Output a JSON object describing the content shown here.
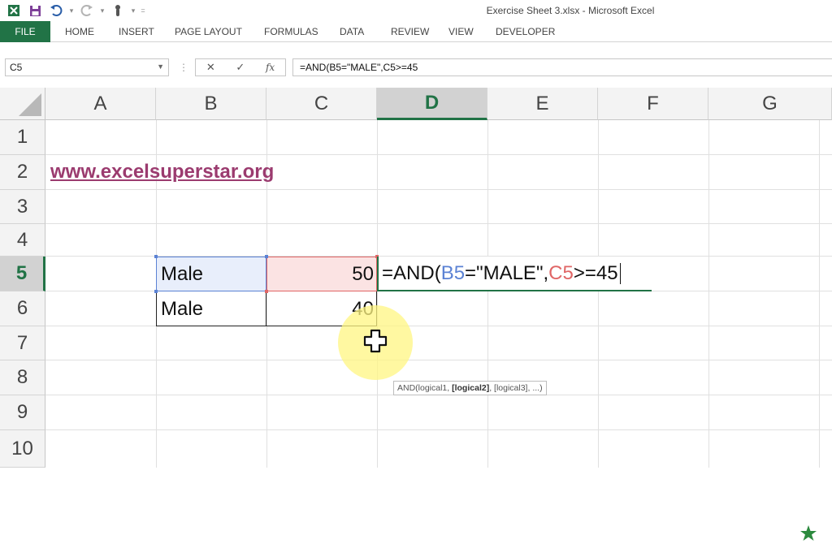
{
  "window": {
    "title": "Exercise Sheet 3.xlsx - Microsoft Excel"
  },
  "ribbon": {
    "file_label": "FILE",
    "tabs": [
      "HOME",
      "INSERT",
      "PAGE LAYOUT",
      "FORMULAS",
      "DATA",
      "REVIEW",
      "VIEW",
      "DEVELOPER"
    ],
    "accent_color": "#217346"
  },
  "formula_bar": {
    "name_box": "C5",
    "cancel_glyph": "✕",
    "enter_glyph": "✓",
    "fx_label": "fx",
    "formula": "=AND(B5=\"MALE\",C5>=45"
  },
  "sheet": {
    "columns": [
      "A",
      "B",
      "C",
      "D",
      "E",
      "F",
      "G"
    ],
    "active_column": "D",
    "rows": [
      "1",
      "2",
      "3",
      "4",
      "5",
      "6",
      "7",
      "8",
      "9",
      "10"
    ],
    "active_row": "5",
    "link_text": "www.excelsuperstar.org",
    "cells": {
      "B5": "Male",
      "C5": "50",
      "B6": "Male",
      "C6": "40"
    },
    "edit": {
      "part1": "=AND(",
      "ref_b": "B5",
      "part2": "=\"MALE\",",
      "ref_c": "C5",
      "part3": ">=45"
    },
    "tooltip": {
      "prefix": "AND(logical1, ",
      "bold": "[logical2]",
      "suffix": ", [logical3], ...)"
    },
    "ref_colors": {
      "b5": "#5b82d4",
      "c5": "#e06666"
    }
  }
}
